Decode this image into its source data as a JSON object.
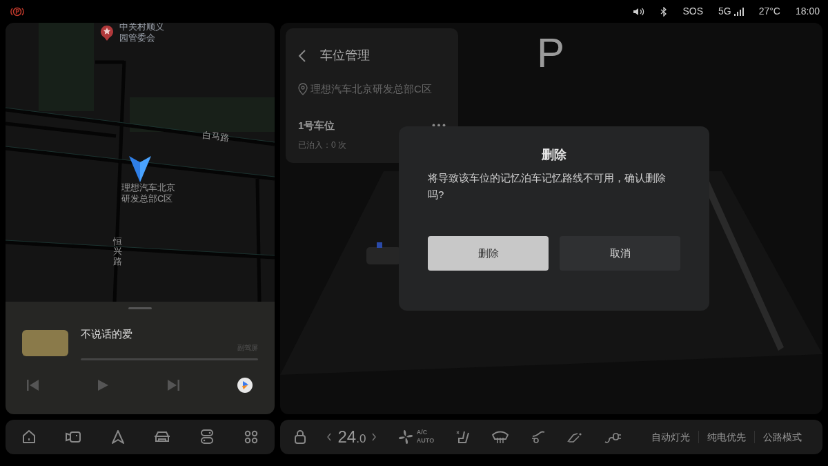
{
  "status_bar": {
    "sos": "SOS",
    "network": "5G",
    "temperature": "27°C",
    "time": "18:00"
  },
  "map": {
    "poi": "中关村顺义园管委会",
    "location": "理想汽车北京研发总部C区",
    "roads": [
      {
        "name": "白马路",
        "kind": "horizontal"
      },
      {
        "name": "恒兴路",
        "kind": "vertical"
      }
    ]
  },
  "media": {
    "title": "不说话的爱",
    "source": "副驾屏",
    "playing": false
  },
  "dock": [
    {
      "kind": "home"
    },
    {
      "kind": "camera"
    },
    {
      "kind": "navigation"
    },
    {
      "kind": "car"
    },
    {
      "kind": "toggles"
    },
    {
      "kind": "apps"
    }
  ],
  "parking": {
    "gear": "P",
    "title": "车位管理",
    "location": "理想汽车北京研发总部C区",
    "spots": [
      {
        "name": "1号车位",
        "count": "已泊入：0 次"
      }
    ]
  },
  "dialog": {
    "title": "删除",
    "message": "将导致该车位的记忆泊车记忆路线不可用，确认删除吗?",
    "buttons": [
      {
        "label": "删除",
        "kind": "primary"
      },
      {
        "label": "取消",
        "kind": "secondary"
      }
    ]
  },
  "climate": {
    "temperature": "24",
    "decimal": ".0",
    "ac": "A/C",
    "mode": "AUTO",
    "quick_buttons": [
      "自动灯光",
      "纯电优先",
      "公路模式"
    ]
  }
}
